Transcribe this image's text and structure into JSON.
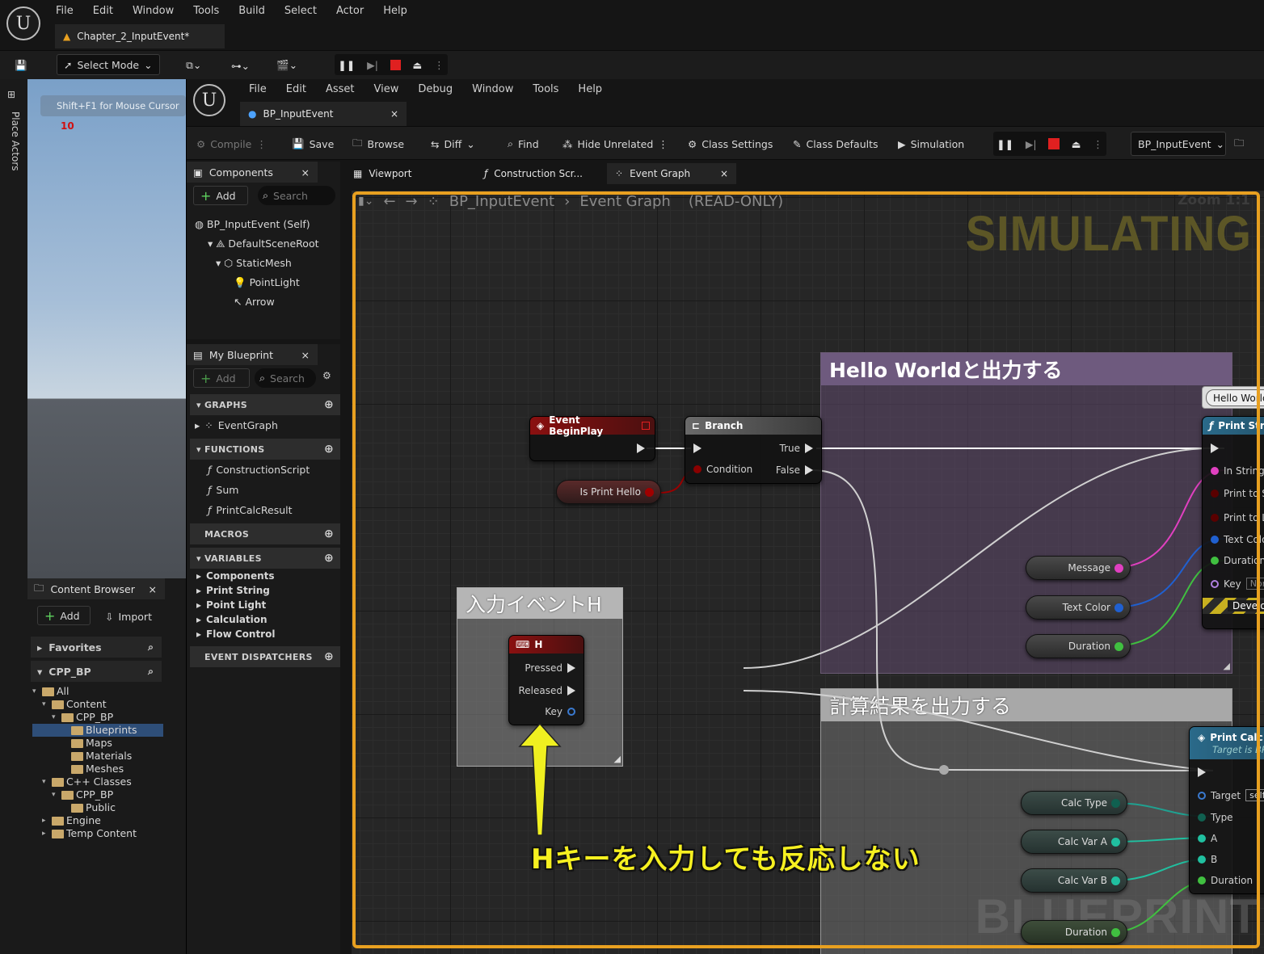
{
  "outer": {
    "menu": [
      "File",
      "Edit",
      "Window",
      "Tools",
      "Build",
      "Select",
      "Actor",
      "Help"
    ],
    "level_tab": "Chapter_2_InputEvent*",
    "select_mode": "Select Mode",
    "place_actors": "Place Actors",
    "viewport_hint": "Shift+F1 for Mouse Cursor",
    "fps": "10"
  },
  "content_browser": {
    "title": "Content Browser",
    "add": "Add",
    "import": "Import",
    "favorites": "Favorites",
    "project": "CPP_BP",
    "tree": [
      {
        "label": "All",
        "depth": 0,
        "selected": false
      },
      {
        "label": "Content",
        "depth": 1,
        "selected": false
      },
      {
        "label": "CPP_BP",
        "depth": 2,
        "selected": false
      },
      {
        "label": "Blueprints",
        "depth": 3,
        "selected": true
      },
      {
        "label": "Maps",
        "depth": 3,
        "selected": false
      },
      {
        "label": "Materials",
        "depth": 3,
        "selected": false
      },
      {
        "label": "Meshes",
        "depth": 3,
        "selected": false
      },
      {
        "label": "C++ Classes",
        "depth": 1,
        "selected": false
      },
      {
        "label": "CPP_BP",
        "depth": 2,
        "selected": false
      },
      {
        "label": "Public",
        "depth": 3,
        "selected": false
      },
      {
        "label": "Engine",
        "depth": 1,
        "selected": false
      },
      {
        "label": "Temp Content",
        "depth": 1,
        "selected": false
      }
    ]
  },
  "bp": {
    "menu": [
      "File",
      "Edit",
      "Asset",
      "View",
      "Debug",
      "Window",
      "Tools",
      "Help"
    ],
    "asset_tab": "BP_InputEvent",
    "toolbar": {
      "compile": "Compile",
      "save": "Save",
      "browse": "Browse",
      "diff": "Diff",
      "find": "Find",
      "hide_unrelated": "Hide Unrelated",
      "class_settings": "Class Settings",
      "class_defaults": "Class Defaults",
      "simulation": "Simulation",
      "debug_object": "BP_InputEvent"
    },
    "components": {
      "title": "Components",
      "add": "Add",
      "search": "Search",
      "items": [
        "BP_InputEvent (Self)",
        "DefaultSceneRoot",
        "StaticMesh",
        "PointLight",
        "Arrow"
      ]
    },
    "my_blueprint": {
      "title": "My Blueprint",
      "add": "Add",
      "search": "Search",
      "graphs_hdr": "GRAPHS",
      "graphs": [
        "EventGraph"
      ],
      "functions_hdr": "FUNCTIONS",
      "functions": [
        "ConstructionScript",
        "Sum",
        "PrintCalcResult"
      ],
      "macros_hdr": "MACROS",
      "variables_hdr": "VARIABLES",
      "variables": [
        "Components",
        "Print String",
        "Point Light",
        "Calculation",
        "Flow Control"
      ],
      "dispatchers_hdr": "EVENT DISPATCHERS"
    },
    "doc_tabs": [
      "Viewport",
      "Construction Scr...",
      "Event Graph"
    ],
    "breadcrumb": {
      "asset": "BP_InputEvent",
      "graph": "Event Graph",
      "mode": "(READ-ONLY)"
    },
    "zoom": "Zoom 1:1",
    "simulating": "SIMULATING",
    "watermark": "BLUEPRINT"
  },
  "graph": {
    "comment_hello": "Hello Worldと出力する",
    "comment_calc": "計算結果を出力する",
    "comment_input": "入力イベントH",
    "bubble": "Hello Worldと出力する",
    "begin_play": "Event BeginPlay",
    "branch": {
      "title": "Branch",
      "condition": "Condition",
      "true": "True",
      "false": "False"
    },
    "is_print_hello": "Is Print Hello",
    "print_string": {
      "title": "Print String",
      "in_string": "In String",
      "print_to_screen": "Print to Screen",
      "print_to_log": "Print to Log",
      "text_color": "Text Color",
      "duration": "Duration",
      "key": "Key",
      "key_value": "None",
      "dev_only": "Development Only"
    },
    "getters_hello": [
      "Message",
      "Text Color",
      "Duration"
    ],
    "key_h": {
      "title": "H",
      "pressed": "Pressed",
      "released": "Released",
      "key": "Key"
    },
    "calc": {
      "title": "Print Calc Result",
      "subtitle": "Target is BP Input Event",
      "target": "Target",
      "target_value": "self",
      "type": "Type",
      "a": "A",
      "b": "B",
      "duration": "Duration"
    },
    "getters_calc": [
      "Calc Type",
      "Calc Var A",
      "Calc Var B",
      "Duration"
    ],
    "annotation": "Hキーを入力しても反応しない"
  },
  "colors": {
    "accent_orange": "#e8a020",
    "exec": "#ffffff",
    "pink": "#e040c0",
    "blue": "#2060d0",
    "green": "#40c040",
    "teal": "#20a090"
  }
}
